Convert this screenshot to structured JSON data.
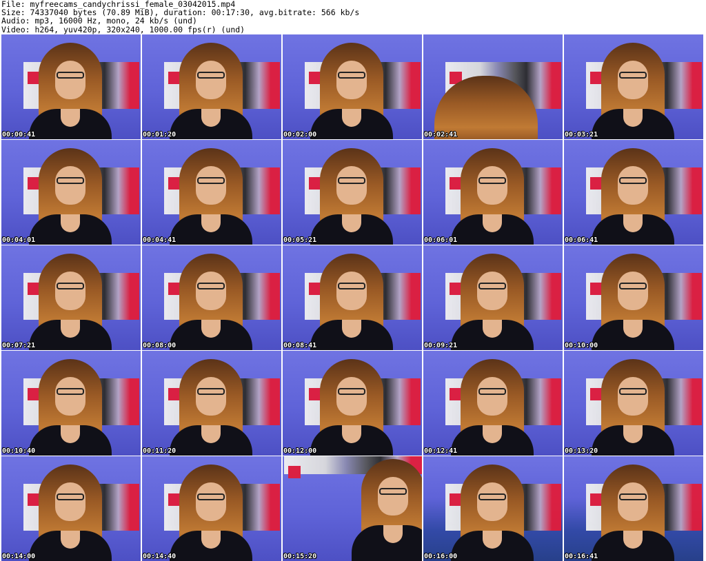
{
  "header": {
    "file": "File: myfreecams_candychrissi_female_03042015.mp4",
    "size": "Size: 74337040 bytes (70.89 MiB), duration: 00:17:30, avg.bitrate: 566 kb/s",
    "audio": "Audio: mp3, 16000 Hz, mono, 24 kb/s (und)",
    "video": "Video: h264, yuv420p, 320x240, 1000.00 fps(r) (und)"
  },
  "thumbnails": [
    {
      "ts": "00:00:41",
      "variant": ""
    },
    {
      "ts": "00:01:20",
      "variant": ""
    },
    {
      "ts": "00:02:00",
      "variant": ""
    },
    {
      "ts": "00:02:41",
      "variant": "back"
    },
    {
      "ts": "00:03:21",
      "variant": ""
    },
    {
      "ts": "00:04:01",
      "variant": ""
    },
    {
      "ts": "00:04:41",
      "variant": ""
    },
    {
      "ts": "00:05:21",
      "variant": ""
    },
    {
      "ts": "00:06:01",
      "variant": ""
    },
    {
      "ts": "00:06:41",
      "variant": ""
    },
    {
      "ts": "00:07:21",
      "variant": ""
    },
    {
      "ts": "00:08:00",
      "variant": ""
    },
    {
      "ts": "00:08:41",
      "variant": ""
    },
    {
      "ts": "00:09:21",
      "variant": ""
    },
    {
      "ts": "00:10:00",
      "variant": ""
    },
    {
      "ts": "00:10:40",
      "variant": ""
    },
    {
      "ts": "00:11:20",
      "variant": ""
    },
    {
      "ts": "00:12:00",
      "variant": ""
    },
    {
      "ts": "00:12:41",
      "variant": ""
    },
    {
      "ts": "00:13:20",
      "variant": ""
    },
    {
      "ts": "00:14:00",
      "variant": ""
    },
    {
      "ts": "00:14:40",
      "variant": ""
    },
    {
      "ts": "00:15:20",
      "variant": "close"
    },
    {
      "ts": "00:16:00",
      "variant": "sofa"
    },
    {
      "ts": "00:16:41",
      "variant": "sofa"
    }
  ]
}
